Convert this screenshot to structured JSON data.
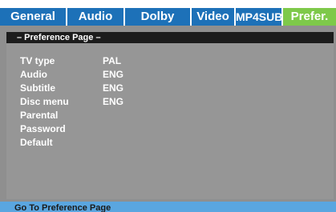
{
  "tabs": [
    {
      "label": "General"
    },
    {
      "label": "Audio"
    },
    {
      "label": "Dolby"
    },
    {
      "label": "Video"
    },
    {
      "label": "MP4SUB"
    },
    {
      "label": "Prefer."
    }
  ],
  "page": {
    "header": "– Preference Page –"
  },
  "settings": [
    {
      "label": "TV type",
      "value": "PAL"
    },
    {
      "label": "Audio",
      "value": "ENG"
    },
    {
      "label": "Subtitle",
      "value": "ENG"
    },
    {
      "label": "Disc menu",
      "value": "ENG"
    },
    {
      "label": "Parental",
      "value": ""
    },
    {
      "label": "Password",
      "value": ""
    },
    {
      "label": "Default",
      "value": ""
    }
  ],
  "footer": {
    "text": "Go To Preference Page"
  },
  "colors": {
    "tab_bg": "#1d71b8",
    "tab_active": "#7ec94a",
    "panel_bg": "#969696",
    "header_bg": "#1c1c1c",
    "footer_bg": "#5aa6e0"
  }
}
